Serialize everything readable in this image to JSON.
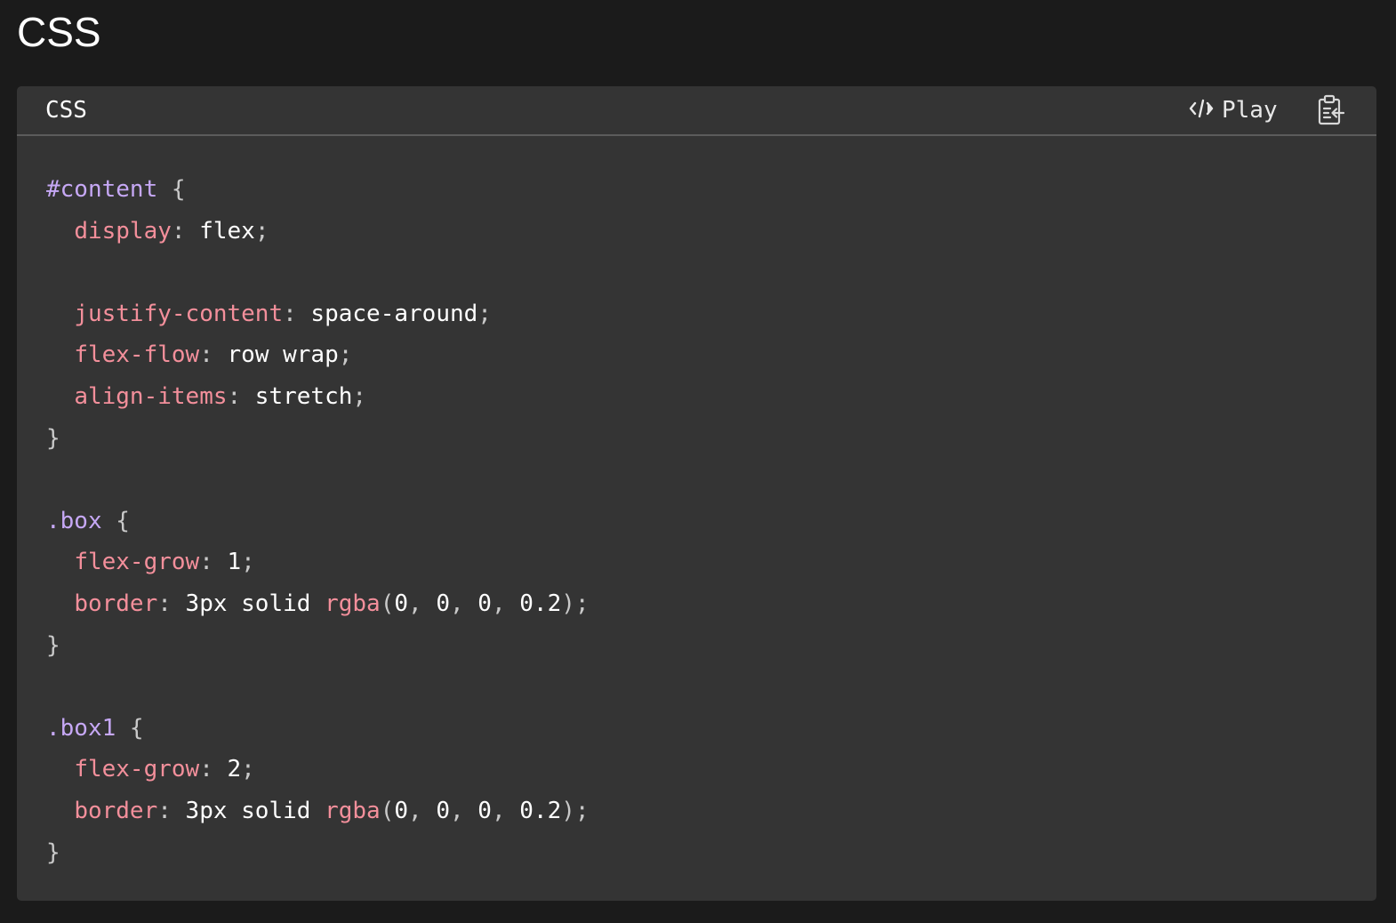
{
  "page": {
    "title": "CSS"
  },
  "code_block": {
    "language_label": "CSS",
    "play_label": "Play",
    "play_icon": "code-brackets-icon",
    "copy_icon": "clipboard-copy-icon",
    "colors": {
      "background": "#343434",
      "selector": "#c6a8f5",
      "property": "#f38f9b",
      "punctuation": "#c9c9c9",
      "value": "#ffffff"
    },
    "lines": [
      [
        {
          "t": "sel",
          "v": "#content"
        },
        {
          "t": "punc",
          "v": " {"
        }
      ],
      [
        {
          "t": "val",
          "v": "  "
        },
        {
          "t": "prop",
          "v": "display"
        },
        {
          "t": "punc",
          "v": ":"
        },
        {
          "t": "val",
          "v": " flex"
        },
        {
          "t": "punc",
          "v": ";"
        }
      ],
      [],
      [
        {
          "t": "val",
          "v": "  "
        },
        {
          "t": "prop",
          "v": "justify-content"
        },
        {
          "t": "punc",
          "v": ":"
        },
        {
          "t": "val",
          "v": " space-around"
        },
        {
          "t": "punc",
          "v": ";"
        }
      ],
      [
        {
          "t": "val",
          "v": "  "
        },
        {
          "t": "prop",
          "v": "flex-flow"
        },
        {
          "t": "punc",
          "v": ":"
        },
        {
          "t": "val",
          "v": " row wrap"
        },
        {
          "t": "punc",
          "v": ";"
        }
      ],
      [
        {
          "t": "val",
          "v": "  "
        },
        {
          "t": "prop",
          "v": "align-items"
        },
        {
          "t": "punc",
          "v": ":"
        },
        {
          "t": "val",
          "v": " stretch"
        },
        {
          "t": "punc",
          "v": ";"
        }
      ],
      [
        {
          "t": "punc",
          "v": "}"
        }
      ],
      [],
      [
        {
          "t": "sel",
          "v": ".box"
        },
        {
          "t": "punc",
          "v": " {"
        }
      ],
      [
        {
          "t": "val",
          "v": "  "
        },
        {
          "t": "prop",
          "v": "flex-grow"
        },
        {
          "t": "punc",
          "v": ":"
        },
        {
          "t": "val",
          "v": " 1"
        },
        {
          "t": "punc",
          "v": ";"
        }
      ],
      [
        {
          "t": "val",
          "v": "  "
        },
        {
          "t": "prop",
          "v": "border"
        },
        {
          "t": "punc",
          "v": ":"
        },
        {
          "t": "val",
          "v": " 3px solid "
        },
        {
          "t": "fn",
          "v": "rgba"
        },
        {
          "t": "punc",
          "v": "("
        },
        {
          "t": "val",
          "v": "0"
        },
        {
          "t": "punc",
          "v": ", "
        },
        {
          "t": "val",
          "v": "0"
        },
        {
          "t": "punc",
          "v": ", "
        },
        {
          "t": "val",
          "v": "0"
        },
        {
          "t": "punc",
          "v": ", "
        },
        {
          "t": "val",
          "v": "0.2"
        },
        {
          "t": "punc",
          "v": ");"
        }
      ],
      [
        {
          "t": "punc",
          "v": "}"
        }
      ],
      [],
      [
        {
          "t": "sel",
          "v": ".box1"
        },
        {
          "t": "punc",
          "v": " {"
        }
      ],
      [
        {
          "t": "val",
          "v": "  "
        },
        {
          "t": "prop",
          "v": "flex-grow"
        },
        {
          "t": "punc",
          "v": ":"
        },
        {
          "t": "val",
          "v": " 2"
        },
        {
          "t": "punc",
          "v": ";"
        }
      ],
      [
        {
          "t": "val",
          "v": "  "
        },
        {
          "t": "prop",
          "v": "border"
        },
        {
          "t": "punc",
          "v": ":"
        },
        {
          "t": "val",
          "v": " 3px solid "
        },
        {
          "t": "fn",
          "v": "rgba"
        },
        {
          "t": "punc",
          "v": "("
        },
        {
          "t": "val",
          "v": "0"
        },
        {
          "t": "punc",
          "v": ", "
        },
        {
          "t": "val",
          "v": "0"
        },
        {
          "t": "punc",
          "v": ", "
        },
        {
          "t": "val",
          "v": "0"
        },
        {
          "t": "punc",
          "v": ", "
        },
        {
          "t": "val",
          "v": "0.2"
        },
        {
          "t": "punc",
          "v": ");"
        }
      ],
      [
        {
          "t": "punc",
          "v": "}"
        }
      ]
    ]
  }
}
